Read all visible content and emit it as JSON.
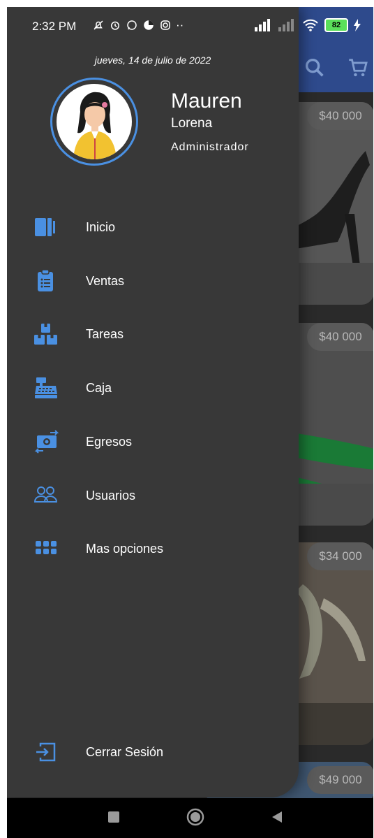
{
  "status_bar": {
    "time": "2:32 PM",
    "battery": "82",
    "overflow": "··"
  },
  "drawer": {
    "date": "jueves, 14 de julio de 2022",
    "user": {
      "first_name": "Mauren",
      "last_name": "Lorena",
      "role": "Administrador"
    },
    "menu": [
      {
        "label": "Inicio",
        "icon": "home-icon"
      },
      {
        "label": "Ventas",
        "icon": "clipboard-list-icon"
      },
      {
        "label": "Tareas",
        "icon": "boxes-icon"
      },
      {
        "label": "Caja",
        "icon": "cash-register-icon"
      },
      {
        "label": "Egresos",
        "icon": "money-exchange-icon"
      },
      {
        "label": "Usuarios",
        "icon": "users-icon"
      },
      {
        "label": "Mas opciones",
        "icon": "grid-icon"
      }
    ],
    "logout": {
      "label": "Cerrar Sesión",
      "icon": "logout-icon"
    }
  },
  "background": {
    "prices": [
      "$40 000",
      "$40 000",
      "$34 000",
      "$49 000"
    ]
  },
  "colors": {
    "accent": "#4a90e2",
    "drawer_bg": "#383838",
    "app_bar": "#2e4a8c"
  }
}
